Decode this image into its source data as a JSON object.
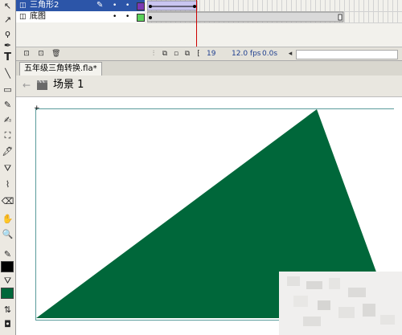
{
  "timeline": {
    "layers": [
      {
        "name": "三角形2",
        "pencil": "✎",
        "dot_visible": "•",
        "dot_lock": "•",
        "color": "#7b39b5",
        "selected": true
      },
      {
        "name": "底图",
        "pencil": "",
        "dot_visible": "•",
        "dot_lock": "•",
        "color": "#5ad25a",
        "selected": false
      }
    ],
    "current_frame": "19",
    "fps": "12.0 fps",
    "elapsed": "0.0s"
  },
  "doc_tab": {
    "label": "五年级三角转换.fla*"
  },
  "scene": {
    "label": "场景 1",
    "back_arrow": "←"
  },
  "stage": {
    "triangle_color": "#00673a"
  },
  "toolbox": {
    "stroke_color": "#000000",
    "fill_color": "#00673a"
  },
  "icons": {
    "arrow": "↖",
    "subselect": "↗",
    "lasso": "ϙ",
    "pen": "✒",
    "text": "T",
    "line": "╲",
    "rect": "▭",
    "pencil": "✎",
    "brush": "✍",
    "free_transform": "⛶",
    "ink": "🖋",
    "bucket": "⛛",
    "eyedropper": "⌇",
    "eraser": "⌫",
    "hand": "✋",
    "zoom": "🔍",
    "stroke_pen": "✎",
    "fill_bucket": "⛛",
    "swap": "⇅"
  }
}
